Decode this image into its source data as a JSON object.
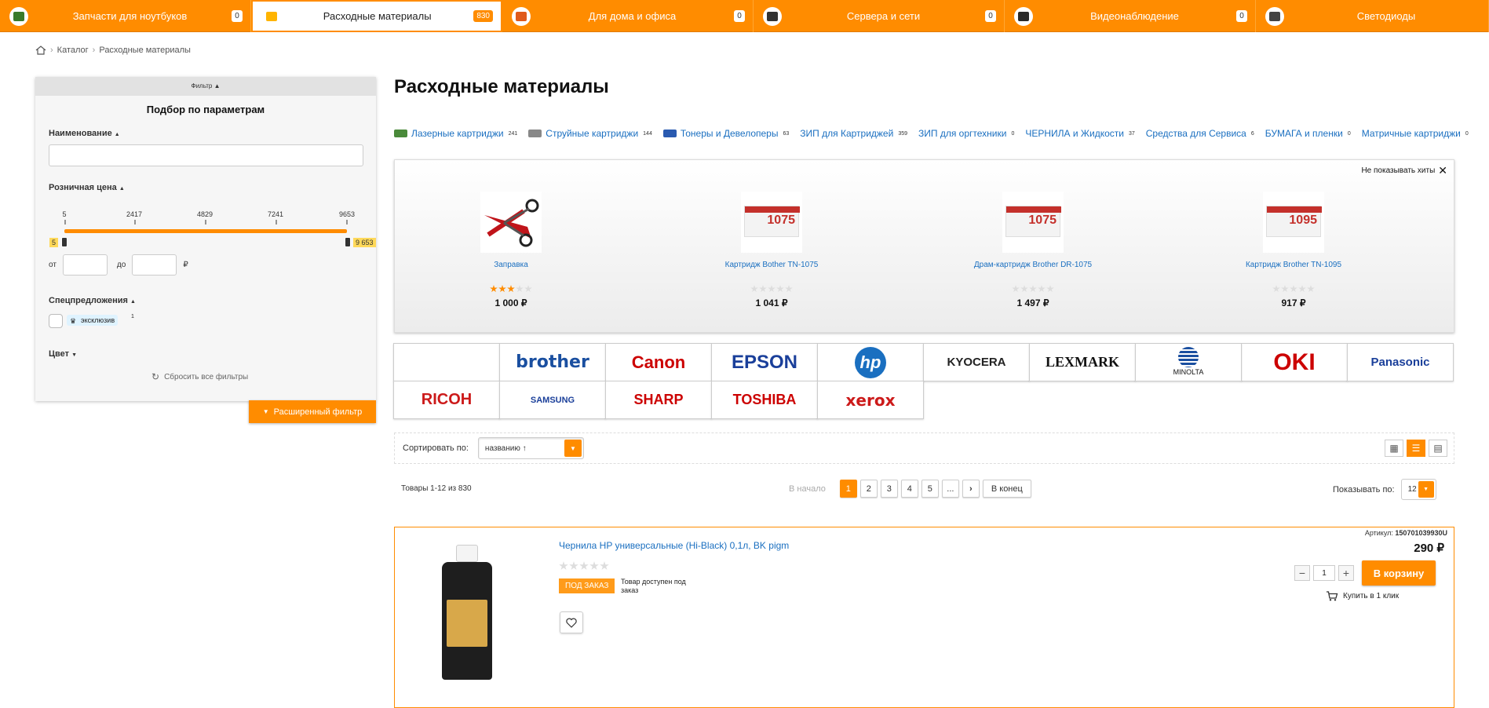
{
  "topnav": [
    {
      "label": "Запчасти для ноутбуков",
      "count": "0",
      "icon": "laptop-parts-icon",
      "icon_color": "#3a7a2a",
      "active": false
    },
    {
      "label": "Расходные материалы",
      "count": "830",
      "icon": "consumables-icon",
      "icon_color": "#ffb400",
      "active": true
    },
    {
      "label": "Для дома и офиса",
      "count": "0",
      "icon": "home-office-icon",
      "icon_color": "#e05a1a",
      "active": false
    },
    {
      "label": "Сервера и сети",
      "count": "0",
      "icon": "server-icon",
      "icon_color": "#333333",
      "active": false
    },
    {
      "label": "Видеонаблюдение",
      "count": "0",
      "icon": "camera-icon",
      "icon_color": "#2a2a2a",
      "active": false
    },
    {
      "label": "Светодиоды",
      "count": "",
      "icon": "led-icon",
      "icon_color": "#444444",
      "active": false
    }
  ],
  "breadcrumb": {
    "items": [
      "Каталог",
      "Расходные материалы"
    ]
  },
  "filter": {
    "toggle_label": "Фильтр",
    "title": "Подбор по параметрам",
    "name_label": "Наименование",
    "price_label": "Розничная цена",
    "price_ticks": [
      "5",
      "2417",
      "4829",
      "7241",
      "9653"
    ],
    "price_min": "5",
    "price_max": "9 653",
    "from_label": "от",
    "to_label": "до",
    "currency": "₽",
    "special_label": "Спецпредложения",
    "exclusive_label": "эксклюзив",
    "exclusive_count": "1",
    "color_label": "Цвет",
    "reset_label": "Сбросить все фильтры",
    "advanced_label": "Расширенный фильтр"
  },
  "page_title": "Расходные материалы",
  "subcategories": [
    {
      "label": "Лазерные картриджи",
      "count": "241",
      "icon_color": "#4a8a3a"
    },
    {
      "label": "Струйные картриджи",
      "count": "144",
      "icon_color": "#888888"
    },
    {
      "label": "Тонеры и Девелоперы",
      "count": "63",
      "icon_color": "#2a5ab0"
    },
    {
      "label": "ЗИП для Картриджей",
      "count": "359",
      "icon_color": ""
    },
    {
      "label": "ЗИП для оргтехники",
      "count": "0",
      "icon_color": ""
    },
    {
      "label": "ЧЕРНИЛА и Жидкости",
      "count": "37",
      "icon_color": ""
    },
    {
      "label": "Средства для Сервиса",
      "count": "6",
      "icon_color": ""
    },
    {
      "label": "БУМАГА и пленки",
      "count": "0",
      "icon_color": ""
    },
    {
      "label": "Матричные картриджи",
      "count": "0",
      "icon_color": ""
    }
  ],
  "hits": {
    "hide_label": "Не показывать хиты",
    "items": [
      {
        "name": "Заправка",
        "price": "1 000 ₽",
        "rating": 3,
        "image": "refill-scissors",
        "num": ""
      },
      {
        "name": "Картридж Bother TN-1075",
        "price": "1 041 ₽",
        "rating": 0,
        "image": "box",
        "num": "1075"
      },
      {
        "name": "Драм-картридж Brother DR-1075",
        "price": "1 497 ₽",
        "rating": 0,
        "image": "box",
        "num": "1075"
      },
      {
        "name": "Картридж Brother TN-1095",
        "price": "917 ₽",
        "rating": 0,
        "image": "box",
        "num": "1095"
      }
    ]
  },
  "brands": [
    {
      "label": "",
      "color": "#000000"
    },
    {
      "label": "brother",
      "color": "#1a4fa0"
    },
    {
      "label": "Canon",
      "color": "#cc0000"
    },
    {
      "label": "EPSON",
      "color": "#1a3f9a"
    },
    {
      "label": "hp",
      "color": "#1a6fc0"
    },
    {
      "label": "KYOCERA",
      "color": "#222222"
    },
    {
      "label": "LEXMARK",
      "color": "#111111"
    },
    {
      "label": "MINOLTA",
      "color": "#1a4fa0"
    },
    {
      "label": "OKI",
      "color": "#cc0000"
    },
    {
      "label": "Panasonic",
      "color": "#1a3f9a"
    },
    {
      "label": "RICOH",
      "color": "#cc1a1a"
    },
    {
      "label": "SAMSUNG",
      "color": "#1a3f9a"
    },
    {
      "label": "SHARP",
      "color": "#cc0000"
    },
    {
      "label": "TOSHIBA",
      "color": "#cc0000"
    },
    {
      "label": "xerox",
      "color": "#cc1a1a"
    }
  ],
  "sort": {
    "label": "Сортировать по:",
    "value": "названию ↑"
  },
  "pagination": {
    "summary": "Товары 1-12 из 830",
    "start_label": "В начало",
    "pages": [
      "1",
      "2",
      "3",
      "4",
      "5",
      "..."
    ],
    "current": "1",
    "end_label": "В конец",
    "per_page_label": "Показывать по:",
    "per_page": "12"
  },
  "product": {
    "name": "Чернила HP универсальные (Hi-Black) 0,1л, BK pigm",
    "sku_label": "Артикул:",
    "sku": "150701039930U",
    "price": "290 ₽",
    "status_badge": "ПОД ЗАКАЗ",
    "availability": "Товар доступен под заказ",
    "quantity": "1",
    "cart_label": "В корзину",
    "one_click_label": "Купить в 1 клик",
    "rating": 0
  },
  "colors": {
    "accent": "#ff8c00",
    "link": "#1a6fc0"
  }
}
